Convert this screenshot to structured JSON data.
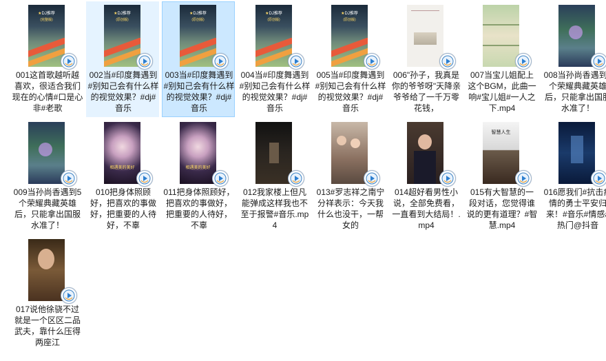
{
  "folder": {
    "items": [
      {
        "name": "001这首歌越听越喜欢，很适合我们现在的心情#口是心非#老歌",
        "thumb": {
          "style": "dj",
          "banner": "DJ推荐",
          "sub": "(完整版)"
        }
      },
      {
        "name": "002当#印度舞遇到#别知己会有什么样的视觉效果？#dj#音乐",
        "thumb": {
          "style": "dj",
          "banner": "DJ推荐",
          "sub": "(原创版)"
        },
        "state": "hover"
      },
      {
        "name": "003当#印度舞遇到#别知己会有什么样的视觉效果？#dj#音乐",
        "thumb": {
          "style": "dj",
          "banner": "DJ推荐",
          "sub": "(原创版)"
        },
        "state": "selected"
      },
      {
        "name": "004当#印度舞遇到#别知己会有什么样的视觉效果？#dj#音乐",
        "thumb": {
          "style": "dj",
          "banner": "DJ推荐",
          "sub": "(原创版)"
        }
      },
      {
        "name": "005当#印度舞遇到#别知己会有什么样的视觉效果？#dj#音乐",
        "thumb": {
          "style": "dj",
          "banner": "DJ推荐",
          "sub": "(原创版)"
        }
      },
      {
        "name": "006\"孙子，我真是你的爷爷呀\"天降亲爷爷给了一千万零花钱，",
        "thumb": {
          "style": "paper"
        }
      },
      {
        "name": "007当宝儿姐配上这个BGM，此曲一响#宝儿姐#一人之下.mp4",
        "thumb": {
          "style": "map"
        }
      },
      {
        "name": "008当孙尚香遇到5个荣耀典藏英雄后，只能拿出国服水准了！",
        "thumb": {
          "style": "game"
        }
      },
      {
        "name": "009当孙尚香遇到5个荣耀典藏英雄后，只能拿出国服水准了！",
        "thumb": {
          "style": "game"
        }
      },
      {
        "name": "010把身体照顾好，把喜欢的事做好，把重要的人待好，不辜",
        "thumb": {
          "style": "portrait",
          "banner": "相遇美的美好"
        }
      },
      {
        "name": "011把身体照顾好，把喜欢的事做好，把重要的人待好，不辜",
        "thumb": {
          "style": "portrait",
          "banner": "相遇美的美好"
        }
      },
      {
        "name": "012我家楼上但凡能弹成这样我也不至于报警#音乐.mp4",
        "thumb": {
          "style": "dark"
        }
      },
      {
        "name": "013#罗志祥之南宁分祥表示：今天我什么也没干，一帮女的",
        "thumb": {
          "style": "crowd"
        }
      },
      {
        "name": "014超好看男性小说，全部免费看，一直看到大结局！.mp4",
        "thumb": {
          "style": "man"
        }
      },
      {
        "name": "015有大智慧的一段对话，您觉得谁说的更有道理？#智慧.mp4",
        "thumb": {
          "style": "talk",
          "banner": "智慧人生"
        }
      },
      {
        "name": "016愿我们#抗击疫情的勇士平安归来！#音乐#情感#热门@抖音",
        "thumb": {
          "style": "blue"
        }
      },
      {
        "name": "017说他徐骁不过就是一个区区二品武夫，靠什么压得两座江",
        "thumb": {
          "style": "drama"
        }
      }
    ]
  },
  "colors": {
    "selected_bg": "#cce8ff",
    "hover_bg": "#e5f3ff",
    "text": "#1b1b1b"
  }
}
